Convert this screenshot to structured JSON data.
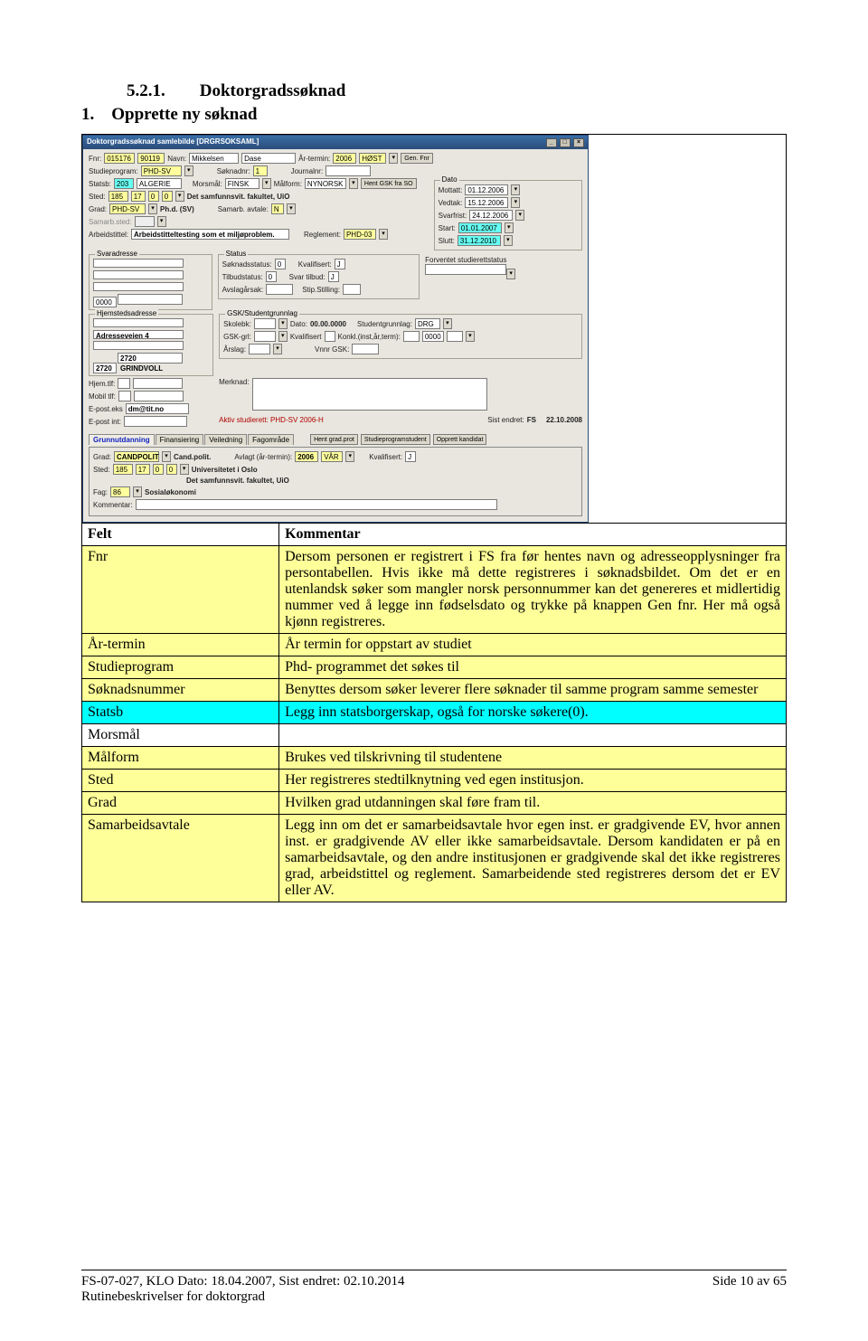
{
  "heading_num": "5.2.1.",
  "heading_title": "Doktorgradssøknad",
  "list_num": "1.",
  "list_title": "Opprette ny søknad",
  "app": {
    "title": "Doktorgradssøknad samlebilde [DRGRSOKSAML]",
    "fnr_lbl": "Fnr:",
    "fnr1": "015176",
    "fnr2": "90119",
    "navn_lbl": "Navn:",
    "navn1": "Mikkelsen",
    "navn2": "Dase",
    "artermin_lbl": "År-termin:",
    "ar": "2006",
    "termin": "HØST",
    "genfnr": "Gen. Fnr",
    "studieprogram_lbl": "Studieprogram:",
    "studieprogram": "PHD-SV",
    "soknadnr_lbl": "Søknadnr:",
    "soknadnr": "1",
    "journalnr_lbl": "Journalnr:",
    "statsb_lbl": "Statsb:",
    "statsb1": "203",
    "statsb2": "ALGERIE",
    "morsmal_lbl": "Morsmål:",
    "morsmal": "FINSK",
    "malform_lbl": "Målform:",
    "malform": "NYNORSK",
    "hentgsk": "Hent GSK fra SO",
    "sted_lbl": "Sted:",
    "sted1": "185",
    "sted2": "17",
    "sted3": "0",
    "sted4": "0",
    "stedtxt": "Det samfunnsvit. fakultet, UiO",
    "grad_lbl": "Grad:",
    "grad": "PHD-SV",
    "gradtxt": "Ph.d. (SV)",
    "samarb_lbl": "Samarb. avtale:",
    "samarb": "N",
    "samarb_sted_lbl": "Samarb.sted:",
    "dato_title": "Dato",
    "mottatt_lbl": "Mottatt:",
    "mottatt": "01.12.2006",
    "vedtak_lbl": "Vedtak:",
    "vedtak": "15.12.2006",
    "svarfrist_lbl": "Svarfrist:",
    "svarfrist": "24.12.2006",
    "start_lbl": "Start:",
    "start": "01.01.2007",
    "slutt_lbl": "Slutt:",
    "slutt": "31.12.2010",
    "arbeidstittel_lbl": "Arbeidstittel:",
    "arbeidstittel": "Arbeidstitteltesting som et miljøproblem.",
    "reglement_lbl": "Reglement:",
    "reglement": "PHD-03",
    "svaradresse_title": "Svaradresse",
    "svaradresse_code": "0000",
    "status_title": "Status",
    "soknadstat_lbl": "Søknadsstatus:",
    "soknadstat": "0",
    "kvalifisert_lbl": "Kvalifisert:",
    "kvalifisert": "J",
    "tilbudstat_lbl": "Tilbudstatus:",
    "tilbudstat": "0",
    "svartilbud_lbl": "Svar tilbud:",
    "svartilbud": "J",
    "avslag_lbl": "Avslagårsak:",
    "stipstilling_lbl": "Stip.Stilling:",
    "forventet_lbl": "Forventet studierettstatus",
    "hjemadr_title": "Hjemstedsadresse",
    "adresse": "Adresseveien 4",
    "post1": "2720",
    "post2": "2720 GRINDVOLL",
    "gsk_title": "GSK/Studentgrunnlag",
    "skolebk_lbl": "Skolebk:",
    "dato00": "Dato:",
    "dato00v": "00.00.0000",
    "studgrunn_lbl": "Studentgrunnlag:",
    "studgrunn": "DRG",
    "gskgrl_lbl": "GSK-grl:",
    "gk_kval_lbl": "Kvalifisert",
    "konkl_lbl": "Konkl.(inst,år,term):",
    "konkl": "0000",
    "arslag_lbl": "Årslag:",
    "vnnrgsk_lbl": "Vnnr GSK:",
    "hjemtlf_lbl": "Hjem.tlf:",
    "mobil_lbl": "Mobil tlf:",
    "epostekst_lbl": "E-post.eks",
    "epostekst": "dm@tit.no",
    "epostint_lbl": "E-post int:",
    "merknad_lbl": "Merknad:",
    "aktiv_lbl": "Aktiv studierett: PHD-SV 2006-H",
    "sist_lbl": "Sist endret:",
    "sist_who": "FS",
    "sist_when": "22.10.2008",
    "tabs": [
      "Grunnutdanning",
      "Finansiering",
      "Veiledning",
      "Fagområde"
    ],
    "tabbtns": [
      "Hent grad.prot",
      "Studieprogramstudent",
      "Opprett kandidat"
    ],
    "gu_grad_lbl": "Grad:",
    "gu_grad1": "CANDPOLIT",
    "gu_grad2": "Cand.polit.",
    "gu_avlagt_lbl": "Avlagt (år-termin):",
    "gu_avlagt": "2006",
    "gu_term": "VÅR",
    "gu_kval_lbl": "Kvalifisert:",
    "gu_kval": "J",
    "gu_sted_lbl": "Sted:",
    "gu_s1": "185",
    "gu_s2": "17",
    "gu_s3": "0",
    "gu_s4": "0",
    "gu_stedtxt1": "Universitetet i Oslo",
    "gu_stedtxt2": "Det samfunnsvit. fakultet, UiO",
    "gu_fag_lbl": "Fag:",
    "gu_fag1": "86",
    "gu_fag2": "Sosialøkonomi",
    "gu_komm_lbl": "Kommentar:"
  },
  "table": {
    "hdr_felt": "Felt",
    "hdr_komm": "Kommentar",
    "rows": [
      {
        "felt": "Fnr",
        "komm": "Dersom personen er registrert i FS fra før hentes navn og adresseopplysninger fra persontabellen. Hvis ikke må dette registreres i søknadsbildet. Om det er en utenlandsk søker som mangler norsk personnummer kan det genereres et midlertidig nummer ved å legge inn fødselsdato og trykke på knappen Gen fnr. Her må også kjønn registreres.",
        "yellow": true
      },
      {
        "felt": "År-termin",
        "komm": "År termin for oppstart av studiet",
        "yellow": true
      },
      {
        "felt": "Studieprogram",
        "komm": "Phd- programmet det søkes til",
        "yellow": true
      },
      {
        "felt": "Søknadsnummer",
        "komm": "Benyttes dersom søker leverer flere søknader til samme program samme semester",
        "yellow": true
      },
      {
        "felt": "Statsb",
        "komm": "Legg inn statsborgerskap, også for norske søkere(0).",
        "cyan": true
      },
      {
        "felt": "Morsmål",
        "komm": "",
        "yellow": false
      },
      {
        "felt": "Målform",
        "komm": "Brukes ved tilskrivning til studentene",
        "yellow": true
      },
      {
        "felt": "Sted",
        "komm": "Her registreres stedtilknytning ved egen institusjon.",
        "yellow": true
      },
      {
        "felt": "Grad",
        "komm": "Hvilken grad utdanningen skal  føre fram til.",
        "yellow": true
      },
      {
        "felt": "Samarbeidsavtale",
        "komm": "Legg inn om det er samarbeidsavtale hvor egen inst. er gradgivende EV, hvor annen inst. er gradgivende AV eller ikke samarbeidsavtale. Dersom kandidaten er på en samarbeidsavtale, og den andre institusjonen er gradgivende skal det ikke registreres grad, arbeidstittel og reglement. Samarbeidende sted registreres dersom det er EV eller AV.",
        "yellow": true
      }
    ]
  },
  "footer_left1": "FS-07-027, KLO Dato: 18.04.2007, Sist endret: 02.10.2014",
  "footer_left2": "Rutinebeskrivelser for doktorgrad",
  "footer_right": "Side 10 av 65"
}
